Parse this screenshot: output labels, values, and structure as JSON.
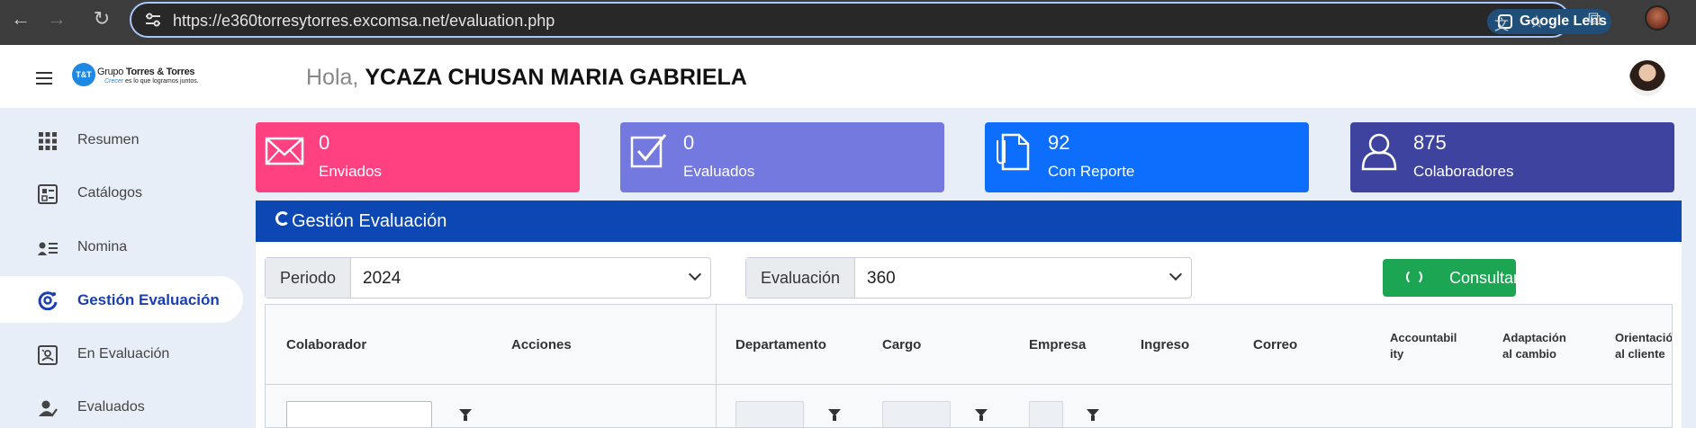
{
  "browser": {
    "url": "https://e360torresytorres.excomsa.net/evaluation.php",
    "lens_label": "Google Lens"
  },
  "header": {
    "logo_line1_a": "Grupo ",
    "logo_line1_b": "Torres & Torres",
    "logo_line2_a": "Crecer",
    "logo_line2_b": " es lo que logramos juntos.",
    "logo_badge": "T&T",
    "greeting_prefix": "Hola, ",
    "user_name": "YCAZA CHUSAN MARIA GABRIELA"
  },
  "sidebar": {
    "items": [
      {
        "label": "Resumen",
        "icon": "grid-icon"
      },
      {
        "label": "Catálogos",
        "icon": "catalog-icon"
      },
      {
        "label": "Nomina",
        "icon": "list-user-icon"
      },
      {
        "label": "Gestión Evaluación",
        "icon": "cycle-icon",
        "active": true
      },
      {
        "label": "En Evaluación",
        "icon": "evaluation-icon"
      },
      {
        "label": "Evaluados",
        "icon": "user-check-icon"
      }
    ]
  },
  "stats": [
    {
      "value": "0",
      "label": "Enviados",
      "color": "#ff4081",
      "icon": "envelope-icon"
    },
    {
      "value": "0",
      "label": "Evaluados",
      "color": "#7479e0",
      "icon": "checkbox-icon"
    },
    {
      "value": "92",
      "label": "Con Reporte",
      "color": "#0d6efd",
      "icon": "document-icon"
    },
    {
      "value": "875",
      "label": "Colaboradores",
      "color": "#3f43a0",
      "icon": "user-icon"
    }
  ],
  "panel": {
    "title": "Gestión Evaluación",
    "periodo_label": "Periodo",
    "periodo_value": "2024",
    "evaluacion_label": "Evaluación",
    "evaluacion_value": "360",
    "consultar_label": "Consultar"
  },
  "table": {
    "columns": {
      "colaborador": "Colaborador",
      "acciones": "Acciones",
      "departamento": "Departamento",
      "cargo": "Cargo",
      "empresa": "Empresa",
      "ingreso": "Ingreso",
      "correo": "Correo",
      "accountability_1": "Accountabil",
      "accountability_2": "ity",
      "adaptacion_1": "Adaptación",
      "adaptacion_2": "al cambio",
      "orientacion_1": "Orientación",
      "orientacion_2": "al cliente"
    }
  }
}
